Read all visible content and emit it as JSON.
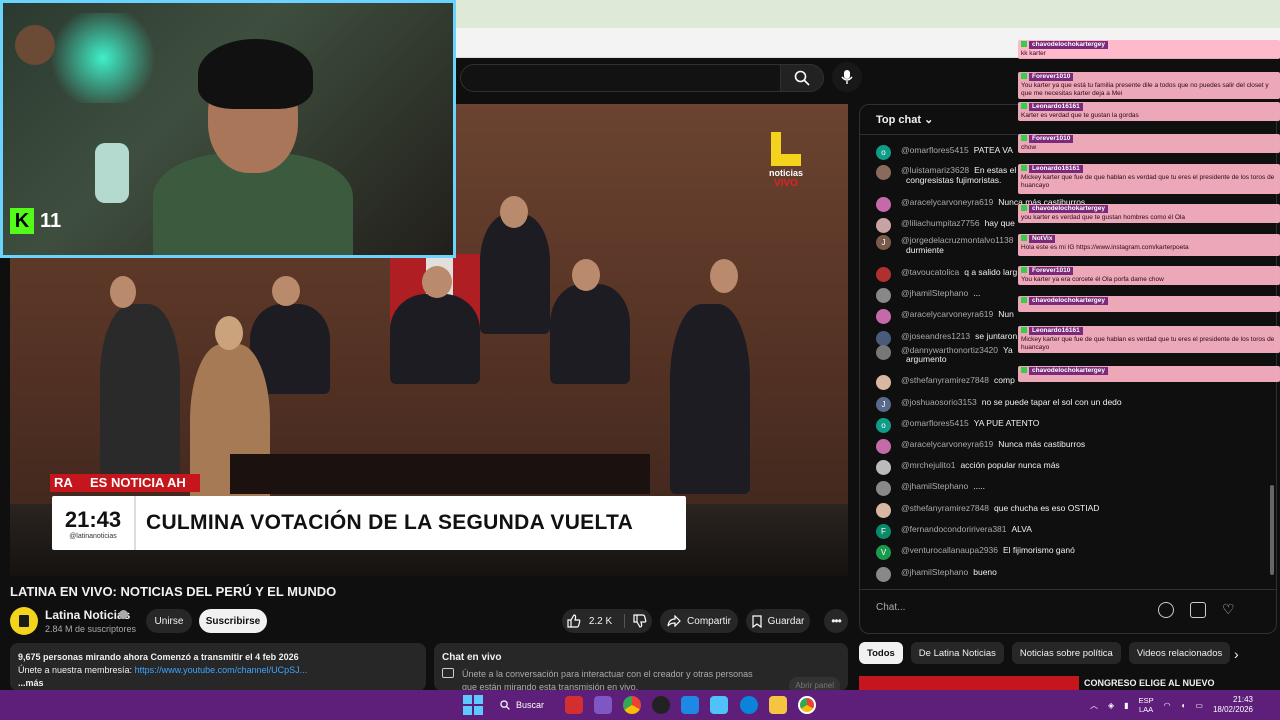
{
  "video": {
    "logo_text": "noticias",
    "logo_live": "VIVO",
    "ticker_red": "ES NOTICIA AH",
    "ticker_prefix": "RA",
    "ticker_time": "21:43",
    "ticker_handle": "@latinanoticias",
    "ticker_headline": "CULMINA VOTACIÓN DE LA SEGUNDA VUELTA"
  },
  "webcam": {
    "viewer_count": "11"
  },
  "info": {
    "title": "LATINA EN VIVO: NOTICIAS DEL PERÚ Y EL MUNDO",
    "channel": "Latina Noticias",
    "subscribers": "2.84 M de suscriptores",
    "join_label": "Unirse",
    "subscribe_label": "Suscribirse",
    "likes": "2.2 K",
    "share_label": "Compartir",
    "save_label": "Guardar"
  },
  "description": {
    "line1": "9,675 personas mirando ahora  Comenzó a transmitir el 4 feb 2026",
    "line2_prefix": "Únete a nuestra membresía: ",
    "link": "https://www.youtube.com/channel/UCpSJ...",
    "more": "...más"
  },
  "livechat_box": {
    "title": "Chat en vivo",
    "text": "Únete a la conversación para interactuar con el creador y otras personas",
    "text2": "que están mirando esta transmisión en vivo.",
    "open_panel": "Abrir panel"
  },
  "chat": {
    "header": "Top chat",
    "input_placeholder": "Chat...",
    "messages": [
      {
        "author": "@omarflores5415",
        "text": "PATEA VA",
        "avatar_color": "#0f9d8a",
        "initial": "o"
      },
      {
        "author": "@luistamariz3628",
        "text": "En estas el",
        "avatar_color": "#8a6a5a",
        "initial": ""
      },
      {
        "author": "",
        "text": "congresistas fujimoristas.",
        "avatar_color": "",
        "initial": ""
      },
      {
        "author": "@aracelycarvoneyra619",
        "text": "Nunca más castiburros",
        "avatar_color": "#c46aa8",
        "initial": ""
      },
      {
        "author": "@liliachumpitaz7756",
        "text": "hay que",
        "avatar_color": "#c7a3a3",
        "initial": ""
      },
      {
        "author": "@jorgedelacruzmontalvo1138",
        "text": "",
        "avatar_color": "#7a5a4a",
        "initial": "J"
      },
      {
        "author": "",
        "text": "durmiente",
        "avatar_color": "",
        "initial": ""
      },
      {
        "author": "@tavoucatolica",
        "text": "q a salido larg",
        "avatar_color": "#b03030",
        "initial": ""
      },
      {
        "author": "@jhamilStephano",
        "text": "...",
        "avatar_color": "#888",
        "initial": ""
      },
      {
        "author": "@aracelycarvoneyra619",
        "text": "Nun",
        "avatar_color": "#c46aa8",
        "initial": ""
      },
      {
        "author": "@joseandres1213",
        "text": "se juntaron",
        "avatar_color": "#4a5a7a",
        "initial": ""
      },
      {
        "author": "@dannywarthonortiz3420",
        "text": "Ya",
        "avatar_color": "#777",
        "initial": ""
      },
      {
        "author": "",
        "text": "argumento",
        "avatar_color": "",
        "initial": ""
      },
      {
        "author": "@sthefanyramirez7848",
        "text": "comp",
        "avatar_color": "#d8b8a0",
        "initial": ""
      },
      {
        "author": "@joshuaosorio3153",
        "text": "no se puede tapar el sol con un dedo",
        "avatar_color": "#5a6a8a",
        "initial": "J"
      },
      {
        "author": "@omarflores5415",
        "text": "YA PUE ATENTO",
        "avatar_color": "#0f9d8a",
        "initial": "o"
      },
      {
        "author": "@aracelycarvoneyra619",
        "text": "Nunca más castiburros",
        "avatar_color": "#c46aa8",
        "initial": ""
      },
      {
        "author": "@mrchejulito1",
        "text": "acción popular nunca más",
        "avatar_color": "#bbb",
        "initial": ""
      },
      {
        "author": "@jhamilStephano",
        "text": ".....",
        "avatar_color": "#888",
        "initial": ""
      },
      {
        "author": "@sthefanyramirez7848",
        "text": "que chucha es eso OSTIAD",
        "avatar_color": "#d8b8a0",
        "initial": ""
      },
      {
        "author": "@fernandocondoririvera381",
        "text": "ALVA",
        "avatar_color": "#0a8a6a",
        "initial": "F"
      },
      {
        "author": "@venturocallanaupa2936",
        "text": "El fijimorismo ganó",
        "avatar_color": "#1a9a4a",
        "initial": "V"
      },
      {
        "author": "@jhamilStephano",
        "text": "bueno",
        "avatar_color": "#888",
        "initial": ""
      }
    ]
  },
  "chips": [
    "Todos",
    "De Latina Noticias",
    "Noticias sobre política",
    "Videos relacionados"
  ],
  "related": {
    "title": "CONGRESO ELIGE AL NUEVO"
  },
  "overlay_chat": [
    {
      "name": "chavodelochokartergey",
      "text": "kk karter"
    },
    {
      "name": "Forever1010",
      "text": "You karter ya que está tu familia presente dile a todos que no puedes salir del closet y que me necesitas karter deja a Mei"
    },
    {
      "name": "Leonardo16161",
      "text": "Karter es verdad que te gustan la gordas"
    },
    {
      "name": "Forever1010",
      "text": "chow"
    },
    {
      "name": "Leonardo16161",
      "text": "Mickey karter que fue de que hablan es verdad que tu eres el presidente de los toros de huancayo"
    },
    {
      "name": "chavodelochokartergey",
      "text": "you karter es verdad que te gustan hombres como él Ola"
    },
    {
      "name": "NotVix",
      "text": "Hola este es mi IG https://www.instagram.com/karterpoeta"
    },
    {
      "name": "Forever1010",
      "text": "You karter ya era corcete él Ola porfa dame chow"
    },
    {
      "name": "chavodelochokartergey",
      "text": ""
    },
    {
      "name": "Leonardo16161",
      "text": "Mickey karter que fue de que hablan es verdad que tu eres el presidente de los toros de huancayo"
    },
    {
      "name": "chavodelochokartergey",
      "text": ""
    }
  ],
  "taskbar": {
    "search_label": "Buscar",
    "lang_top": "ESP",
    "lang_bottom": "LAA",
    "time": "21:43",
    "date": "18/02/2026"
  }
}
